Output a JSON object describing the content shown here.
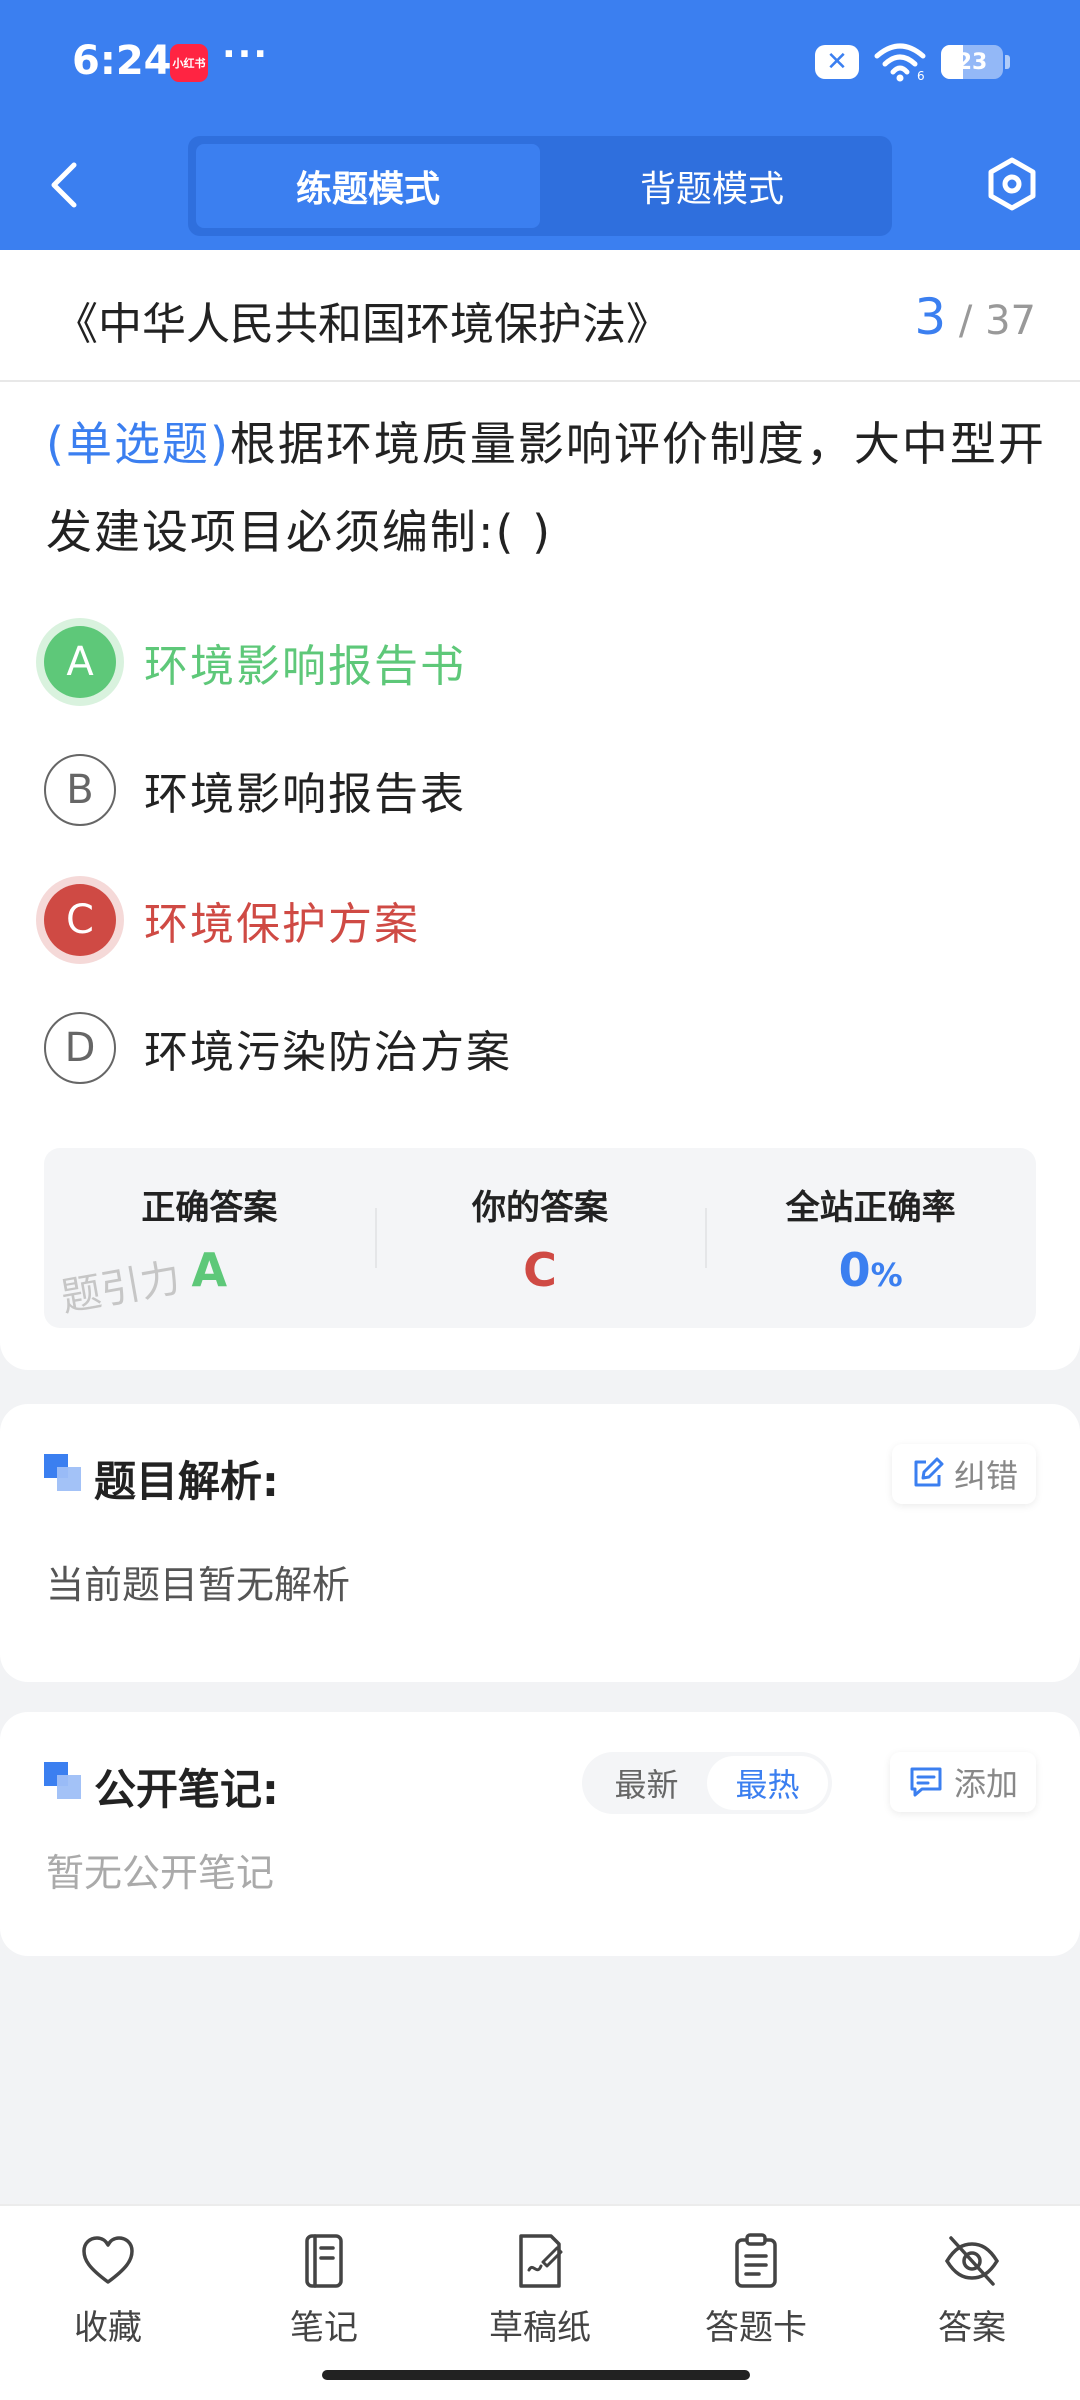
{
  "status_bar": {
    "time": "6:24",
    "app_badge": "小红书",
    "more": "···",
    "sim_icon": "sim-off-icon",
    "battery": "23"
  },
  "header": {
    "modes": [
      "练题模式",
      "背题模式"
    ],
    "active_mode": 0
  },
  "question_card": {
    "law_title": "《中华人民共和国环境保护法》",
    "current": "3",
    "separator": "/",
    "total": "37",
    "question_type": "(单选题)",
    "question_text": "根据环境质量影响评价制度，大中型开发建设项目必须编制:(        )",
    "options": [
      {
        "letter": "A",
        "text": "环境影响报告书",
        "state": "correct"
      },
      {
        "letter": "B",
        "text": "环境影响报告表",
        "state": "normal"
      },
      {
        "letter": "C",
        "text": "环境保护方案",
        "state": "wrong"
      },
      {
        "letter": "D",
        "text": "环境污染防治方案",
        "state": "normal"
      }
    ],
    "answer_summary": {
      "correct_label": "正确答案",
      "correct_value": "A",
      "yours_label": "你的答案",
      "yours_value": "C",
      "rate_label": "全站正确率",
      "rate_value": "0",
      "rate_unit": "%"
    },
    "watermark": "题引力"
  },
  "analysis": {
    "title": "题目解析:",
    "report_button": "纠错",
    "body": "当前题目暂无解析"
  },
  "notes": {
    "title": "公开笔记:",
    "sort_options": [
      "最新",
      "最热"
    ],
    "active_sort": 1,
    "add_button": "添加",
    "body": "暂无公开笔记"
  },
  "bottom_bar": {
    "items": [
      "收藏",
      "笔记",
      "草稿纸",
      "答题卡",
      "答案"
    ]
  },
  "colors": {
    "primary": "#3b7ff0",
    "correct": "#5ec879",
    "wrong": "#cf4a44"
  }
}
